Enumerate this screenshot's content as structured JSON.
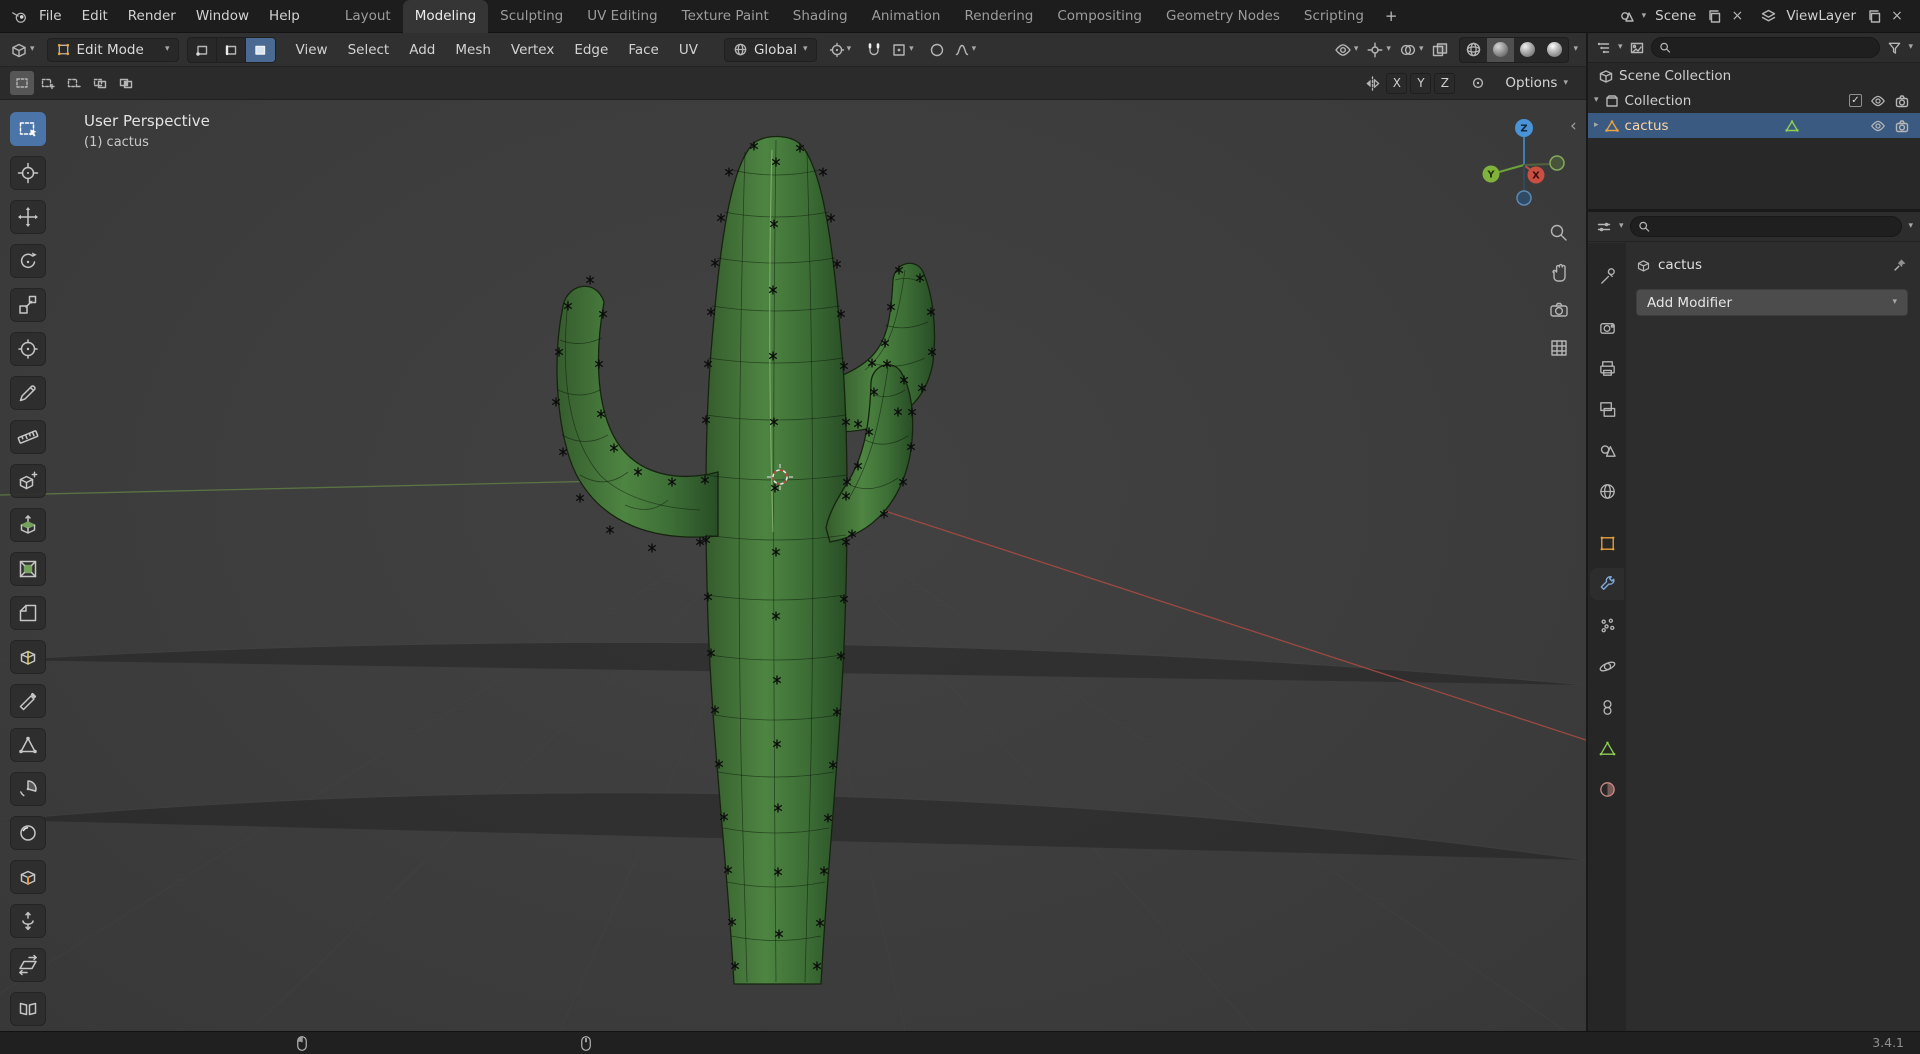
{
  "icons": {
    "caret_down": "▾",
    "caret_right": "▸",
    "check": "✓",
    "collapse_left": "‹",
    "close": "×"
  },
  "topbar": {
    "menus": [
      "File",
      "Edit",
      "Render",
      "Window",
      "Help"
    ],
    "workspaces": [
      {
        "label": "Layout",
        "active": false
      },
      {
        "label": "Modeling",
        "active": true
      },
      {
        "label": "Sculpting",
        "active": false
      },
      {
        "label": "UV Editing",
        "active": false
      },
      {
        "label": "Texture Paint",
        "active": false
      },
      {
        "label": "Shading",
        "active": false
      },
      {
        "label": "Animation",
        "active": false
      },
      {
        "label": "Rendering",
        "active": false
      },
      {
        "label": "Compositing",
        "active": false
      },
      {
        "label": "Geometry Nodes",
        "active": false
      },
      {
        "label": "Scripting",
        "active": false
      }
    ],
    "add_workspace_label": "+",
    "scene": {
      "name": "Scene"
    },
    "view_layer": {
      "name": "ViewLayer"
    }
  },
  "viewport": {
    "header": {
      "mode": "Edit Mode",
      "menus": [
        "View",
        "Select",
        "Add",
        "Mesh",
        "Vertex",
        "Edge",
        "Face",
        "UV"
      ],
      "orientation": "Global"
    },
    "tool_settings": {
      "axes": [
        "X",
        "Y",
        "Z"
      ],
      "options_label": "Options"
    },
    "overlay": {
      "perspective": "User Perspective",
      "active_object": "(1) cactus"
    },
    "gizmo_axes": {
      "x": "X",
      "y": "Y",
      "z": "Z"
    }
  },
  "toolbar": {
    "active_tool": "select-box",
    "tools": [
      "select-box",
      "cursor",
      "move",
      "rotate",
      "scale",
      "transform",
      "annotate",
      "measure",
      "add-cube",
      "extrude-region",
      "inset-faces",
      "bevel",
      "loop-cut",
      "knife",
      "poly-build",
      "spin",
      "smooth",
      "edge-slide",
      "shrink-fatten",
      "shear",
      "rip-region"
    ]
  },
  "outliner": {
    "rows": [
      {
        "label": "Scene Collection",
        "selected": false
      },
      {
        "label": "Collection",
        "selected": false
      },
      {
        "label": "cactus",
        "selected": true
      }
    ]
  },
  "properties": {
    "breadcrumb_object": "cactus",
    "add_modifier_label": "Add Modifier"
  },
  "statusbar": {
    "version": "3.4.1"
  },
  "colors": {
    "accent": "#4772b3",
    "axis_x": "#a64b42",
    "axis_y": "#6fa838",
    "axis_z": "#3b83bd",
    "cactus": "#4e8542"
  }
}
